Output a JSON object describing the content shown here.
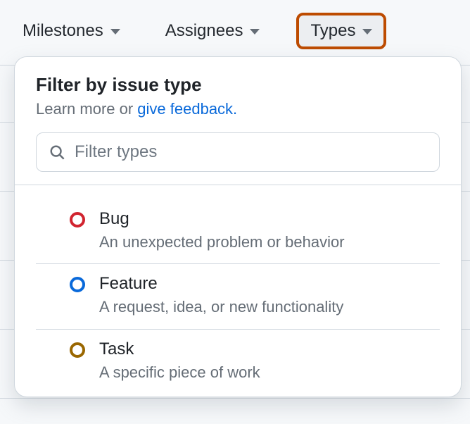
{
  "toolbar": {
    "tabs": [
      {
        "label": "Milestones",
        "active": false
      },
      {
        "label": "Assignees",
        "active": false
      },
      {
        "label": "Types",
        "active": true
      }
    ]
  },
  "panel": {
    "title": "Filter by issue type",
    "subtitle_prefix": "Learn more or ",
    "subtitle_link": "give feedback.",
    "search_placeholder": "Filter types",
    "items": [
      {
        "name": "Bug",
        "desc": "An unexpected problem or behavior",
        "color": "#d1242f"
      },
      {
        "name": "Feature",
        "desc": "A request, idea, or new functionality",
        "color": "#0969da"
      },
      {
        "name": "Task",
        "desc": "A specific piece of work",
        "color": "#9a6700"
      }
    ]
  }
}
